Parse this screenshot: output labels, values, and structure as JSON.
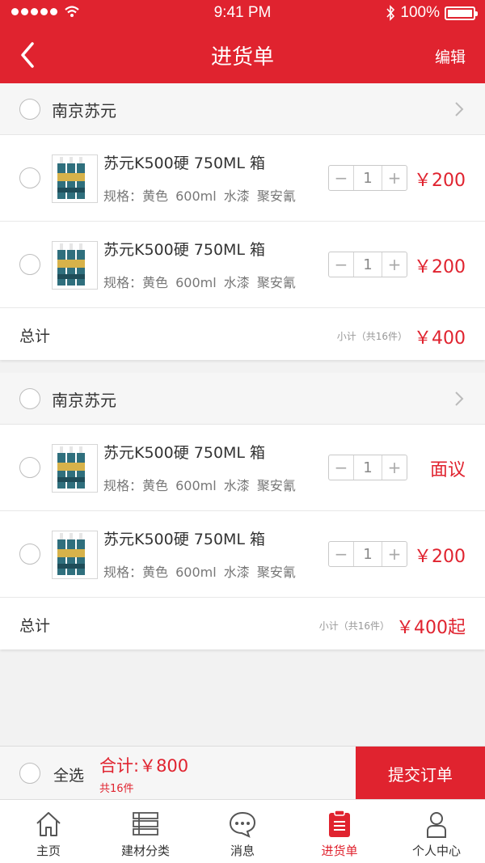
{
  "status_bar": {
    "time": "9:41 PM",
    "battery": "100%"
  },
  "nav": {
    "title": "进货单",
    "edit": "编辑"
  },
  "groups": [
    {
      "shop_name": "南京苏元",
      "items": [
        {
          "title": "苏元K500硬 750ML 箱",
          "spec": "规格：黄色 600ml 水漆 聚安氰",
          "qty": "1",
          "price": "￥200"
        },
        {
          "title": "苏元K500硬 750ML 箱",
          "spec": "规格：黄色 600ml 水漆 聚安氰",
          "qty": "1",
          "price": "￥200"
        }
      ],
      "total_label": "总计",
      "total_sub": "小计（共16件）",
      "total_amount": "￥400"
    },
    {
      "shop_name": "南京苏元",
      "items": [
        {
          "title": "苏元K500硬 750ML 箱",
          "spec": "规格：黄色 600ml 水漆 聚安氰",
          "qty": "1",
          "price": "面议"
        },
        {
          "title": "苏元K500硬 750ML 箱",
          "spec": "规格：黄色 600ml 水漆 聚安氰",
          "qty": "1",
          "price": "￥200"
        }
      ],
      "total_label": "总计",
      "total_sub": "小计（共16件）",
      "total_amount": "￥400起"
    }
  ],
  "checkout": {
    "select_all": "全选",
    "sum": "合计:￥800",
    "count": "共16件",
    "submit": "提交订单"
  },
  "tabs": [
    {
      "label": "主页",
      "icon": "home-icon"
    },
    {
      "label": "建材分类",
      "icon": "list-icon"
    },
    {
      "label": "消息",
      "icon": "chat-icon"
    },
    {
      "label": "进货单",
      "icon": "clipboard-icon"
    },
    {
      "label": "个人中心",
      "icon": "user-icon"
    }
  ],
  "colors": {
    "accent": "#e0232f",
    "background": "#f2f2f2"
  }
}
